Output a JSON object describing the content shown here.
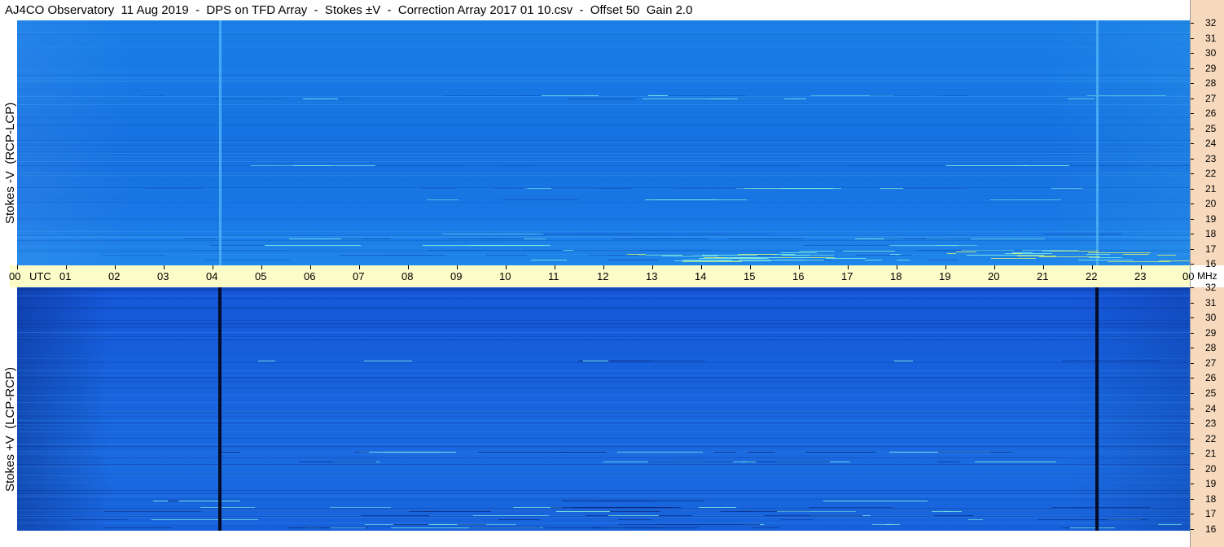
{
  "title": "AJ4CO Observatory  11 Aug 2019  -  DPS on TFD Array  -  Stokes ±V  -  Correction Array 2017 01 10.csv  -  Offset 50  Gain 2.0",
  "panels": {
    "top_label": "Stokes -V  (RCP-LCP)",
    "bottom_label": "Stokes +V  (LCP-RCP)"
  },
  "colors": {
    "time_axis_bg": "#fcfcc8",
    "freq_axis_bg": "#f7d9bd",
    "top_base": "#1776e4",
    "bottom_base": "#1763dc"
  },
  "chart_data": {
    "type": "heatmap",
    "title": "AJ4CO Observatory  11 Aug 2019  -  DPS on TFD Array  -  Stokes ±V  -  Correction Array 2017 01 10.csv  -  Offset 50  Gain 2.0",
    "xlabel": "UTC",
    "ylabel": "MHz",
    "x_tick_labels": [
      "00",
      "01",
      "02",
      "03",
      "04",
      "05",
      "06",
      "07",
      "08",
      "09",
      "10",
      "11",
      "12",
      "13",
      "14",
      "15",
      "16",
      "17",
      "18",
      "19",
      "20",
      "21",
      "22",
      "23",
      "00"
    ],
    "y_tick_labels": [
      "32",
      "31",
      "30",
      "29",
      "28",
      "27",
      "26",
      "25",
      "24",
      "23",
      "22",
      "21",
      "20",
      "19",
      "18",
      "17",
      "16"
    ],
    "xlim": [
      0,
      24
    ],
    "ylim": [
      16,
      32
    ],
    "series": [
      {
        "name": "Stokes -V  (RCP-LCP)",
        "vertical_lines_utc": [
          4.15,
          22.1
        ],
        "line_style": "light"
      },
      {
        "name": "Stokes +V  (LCP-RCP)",
        "vertical_lines_utc": [
          4.15,
          22.1
        ],
        "line_style": "dark"
      }
    ]
  }
}
